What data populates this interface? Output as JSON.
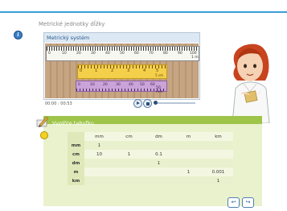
{
  "topbar": {},
  "lesson": {
    "title": "Metrické jednotky dĺžky",
    "info_icon": "info-icon"
  },
  "video": {
    "title": "Metrický systém",
    "metre_ruler": {
      "numbers": [
        "0",
        "10",
        "20",
        "30",
        "40",
        "50",
        "60",
        "70",
        "80",
        "90",
        "100"
      ],
      "unit": "1 m"
    },
    "cm_ruler": {
      "numbers": [
        "0",
        "1",
        "2",
        "3",
        "4",
        "5"
      ],
      "unit": "5 cm"
    },
    "mm_ruler": {
      "numbers": [
        "0",
        "10",
        "20",
        "30",
        "40",
        "50",
        "60"
      ],
      "unit": "50 mm"
    },
    "time": "00:00 : 00:53",
    "progress": 0.0,
    "play_icon": "play-icon",
    "stop_icon": "stop-icon"
  },
  "task": {
    "label": "Vyplňte tabuľku.",
    "pencil_icon": "pencil-icon",
    "hint_icon": "bulb-icon"
  },
  "table": {
    "columns": [
      "",
      "mm",
      "cm",
      "dm",
      "m",
      "km"
    ],
    "rows": [
      {
        "unit": "mm",
        "cells": [
          "1",
          "",
          "",
          "",
          ""
        ]
      },
      {
        "unit": "cm",
        "cells": [
          "10",
          "1",
          "0.1",
          "",
          ""
        ]
      },
      {
        "unit": "dm",
        "cells": [
          "",
          "",
          "1",
          "",
          ""
        ]
      },
      {
        "unit": "m",
        "cells": [
          "",
          "",
          "",
          "1",
          "0.001"
        ]
      },
      {
        "unit": "km",
        "cells": [
          "",
          "",
          "",
          "",
          "1"
        ]
      }
    ]
  },
  "nav": {
    "back_icon": "back-icon",
    "next_icon": "next-icon"
  },
  "colors": {
    "accent": "#3a9fd9",
    "task_header": "#9ec54a",
    "task_bg": "#e9f2cc"
  }
}
